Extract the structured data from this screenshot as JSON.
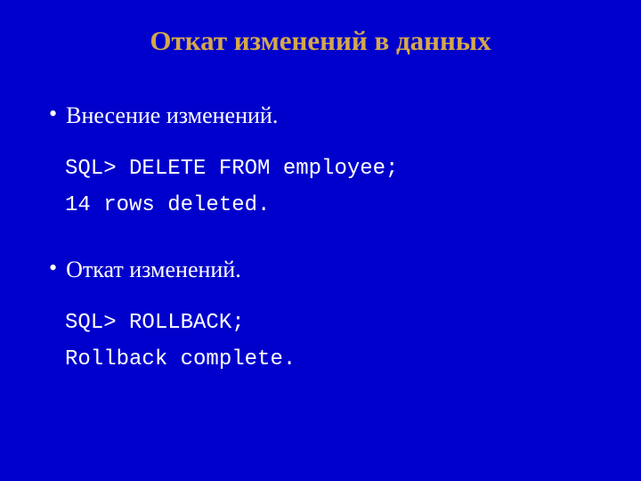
{
  "title": "Откат изменений в данных",
  "section1": {
    "bullet": "•",
    "text": "Внесение изменений.",
    "code1": "SQL> DELETE FROM employee;",
    "code2": "14 rows deleted."
  },
  "section2": {
    "bullet": "•",
    "text": "Откат изменений.",
    "code1": "SQL> ROLLBACK;",
    "code2": "Rollback complete."
  }
}
